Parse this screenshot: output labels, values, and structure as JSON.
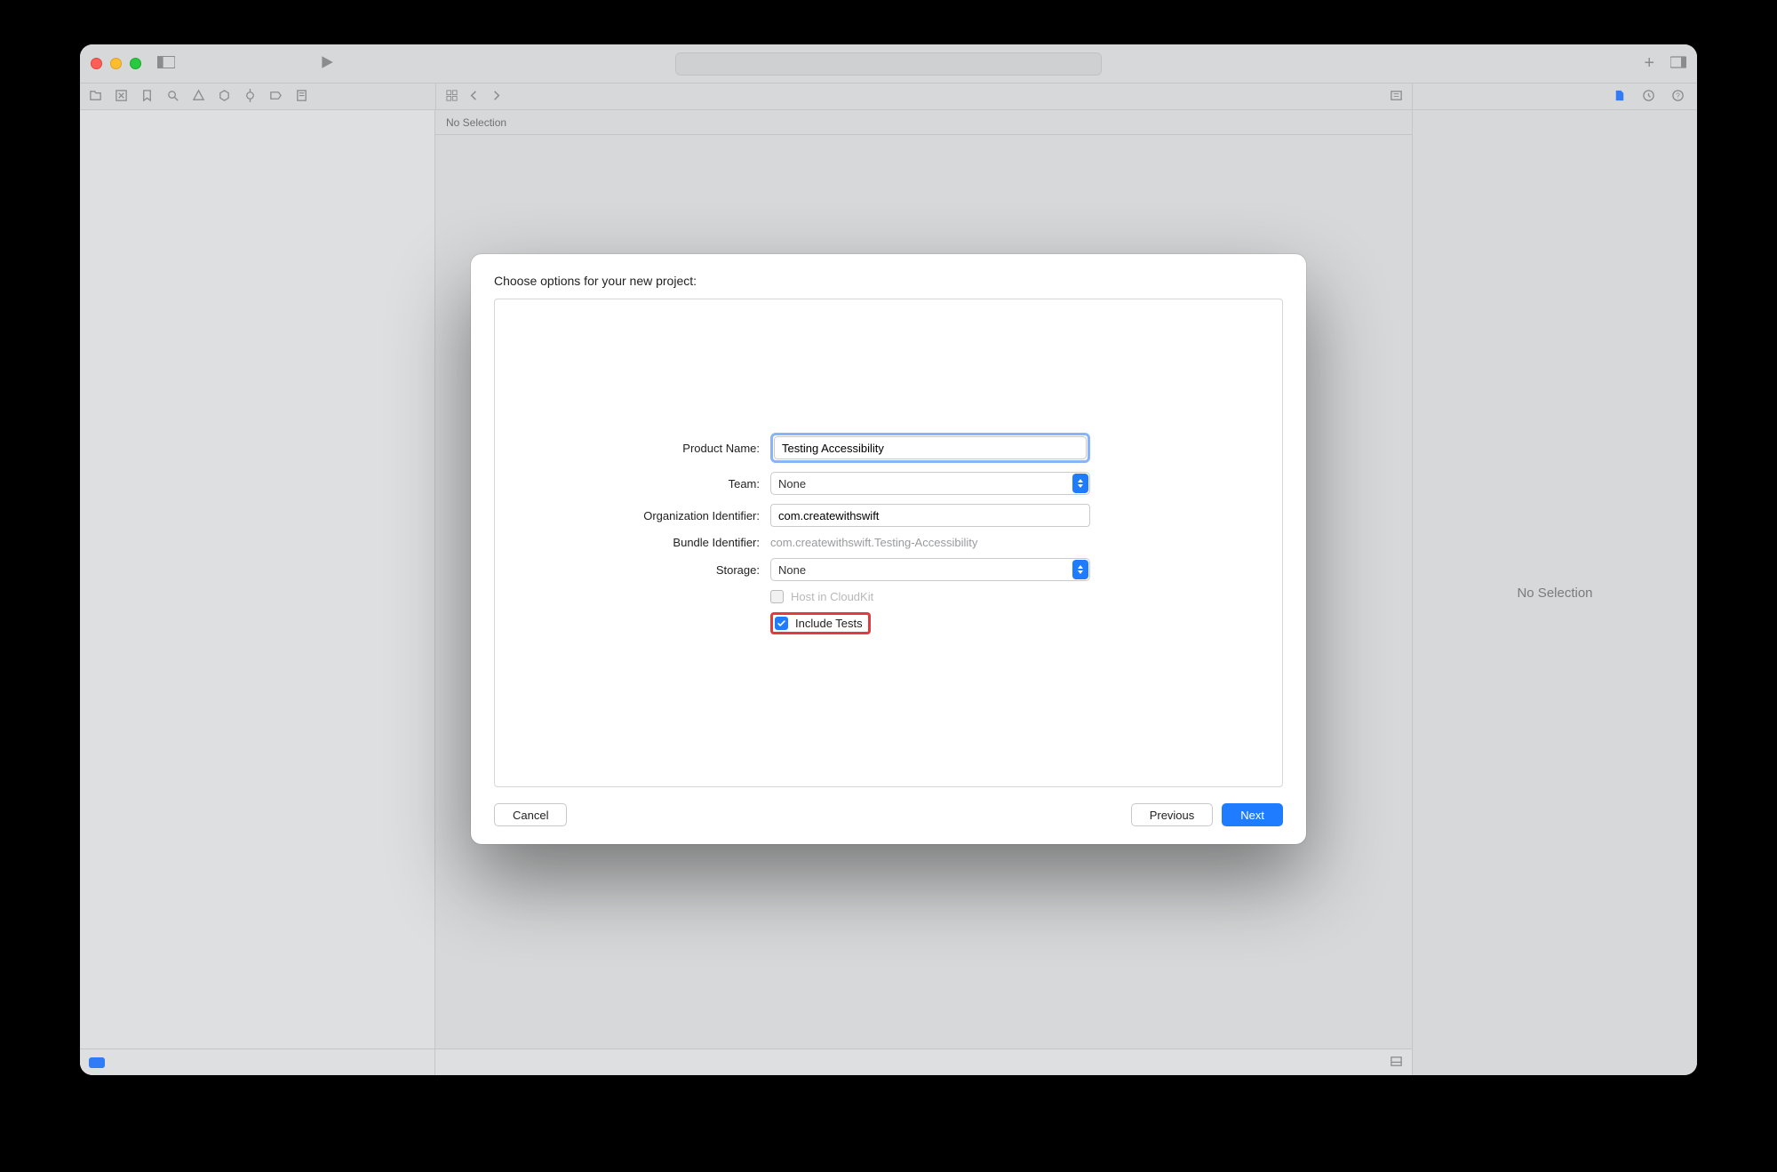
{
  "editor": {
    "jumpbar": "No Selection"
  },
  "inspector": {
    "placeholder": "No Selection"
  },
  "sheet": {
    "title": "Choose options for your new project:",
    "labels": {
      "product_name": "Product Name:",
      "team": "Team:",
      "org_id": "Organization Identifier:",
      "bundle_id": "Bundle Identifier:",
      "storage": "Storage:",
      "host_cloudkit": "Host in CloudKit",
      "include_tests": "Include Tests"
    },
    "values": {
      "product_name": "Testing Accessibility",
      "team": "None",
      "org_id": "com.createwithswift",
      "bundle_id": "com.createwithswift.Testing-Accessibility",
      "storage": "None",
      "host_cloudkit_checked": false,
      "include_tests_checked": true
    },
    "buttons": {
      "cancel": "Cancel",
      "previous": "Previous",
      "next": "Next"
    }
  }
}
